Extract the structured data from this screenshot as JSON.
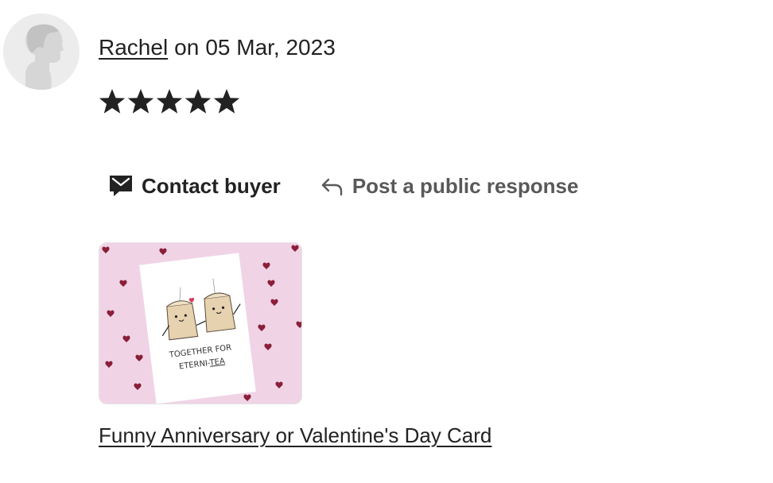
{
  "review": {
    "reviewer_name": "Rachel",
    "date_prefix": "on",
    "date": "05 Mar, 2023",
    "rating": 5,
    "rating_max": 5
  },
  "actions": {
    "contact_buyer_label": "Contact buyer",
    "contact_icon": "envelope-icon",
    "public_response_label": "Post a public response",
    "public_response_icon": "reply-arrow-icon"
  },
  "product": {
    "image_text_line1": "TOGETHER FOR",
    "image_text_line2_prefix": "ETERNI-",
    "image_text_line2_suffix": "TEA",
    "link_label": "Funny Anniversary or Valentine's Day Card"
  },
  "colors": {
    "text": "#222222",
    "muted_text": "#595959",
    "avatar_bg": "#ececec",
    "thumb_bg": "#f0d4e6",
    "heart": "#8a1f3a"
  }
}
